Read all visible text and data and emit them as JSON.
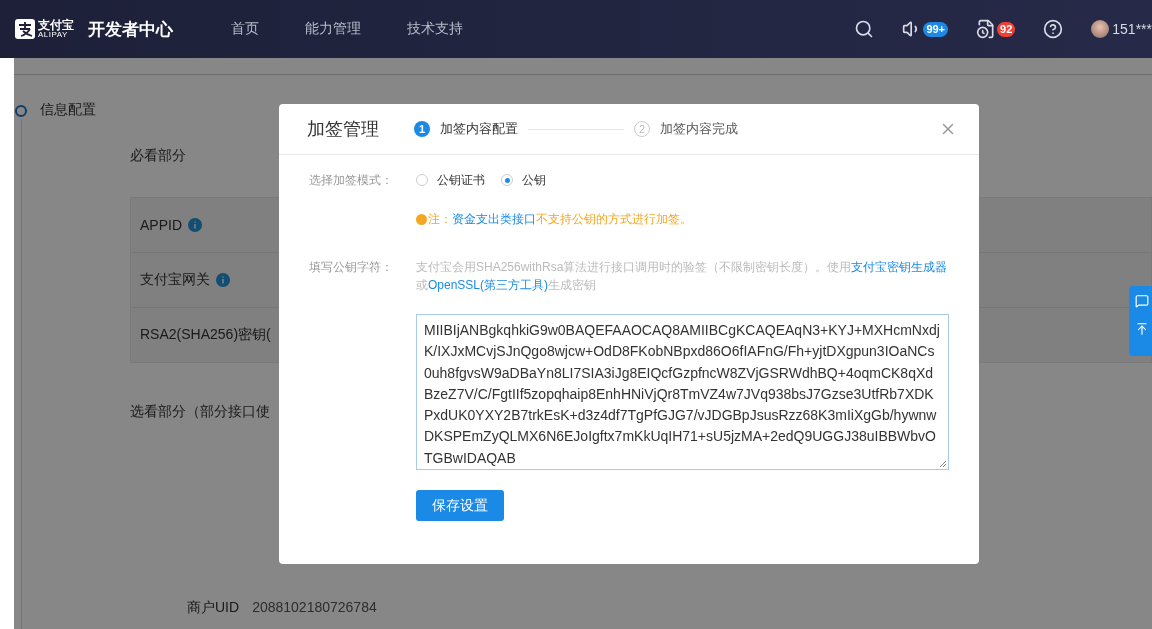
{
  "header": {
    "logo": {
      "name": "支付宝",
      "sub": "ALIPAY"
    },
    "title": "开发者中心",
    "nav": [
      {
        "label": "首页"
      },
      {
        "label": "能力管理"
      },
      {
        "label": "技术支持"
      }
    ],
    "notifications": [
      {
        "kind": "sound",
        "badge": "99+",
        "color": "#1e88e5"
      },
      {
        "kind": "task",
        "badge": "92",
        "color": "#f04134"
      }
    ],
    "user": "151***"
  },
  "page": {
    "section": "信息配置",
    "required_title": "必看部分",
    "required_rows": [
      {
        "label": "APPID",
        "info": true
      },
      {
        "label": "支付宝网关",
        "info": true
      },
      {
        "label": "RSA2(SHA256)密钥(",
        "info": false
      }
    ],
    "optional_title": "选看部分（部分接口使",
    "uid": {
      "label": "商户UID",
      "value": "2088102180726784"
    }
  },
  "modal": {
    "title": "加签管理",
    "steps": [
      {
        "number": "1",
        "label": "加签内容配置",
        "selected": true
      },
      {
        "number": "2",
        "label": "加签内容完成",
        "selected": false
      }
    ],
    "mode_label": "选择加签模式：",
    "modes": [
      {
        "label": "公钥证书",
        "selected": false
      },
      {
        "label": "公钥",
        "selected": true
      }
    ],
    "note": [
      {
        "kind": "warn",
        "text": "注："
      },
      {
        "kind": "link",
        "text": "资金支出类接口"
      },
      {
        "kind": "warn",
        "text": "不支持公钥的方式进行加签。"
      }
    ],
    "key_label": "填写公钥字符：",
    "hint": [
      {
        "kind": "plain",
        "text": "支付宝会用SHA256withRsa算法进行接口调用时的验签（不限制密钥长度）。使用"
      },
      {
        "kind": "link",
        "text": "支付宝密钥生成器"
      },
      {
        "kind": "plain",
        "text": "或"
      },
      {
        "kind": "link",
        "text": "OpenSSL(第三方工具)"
      },
      {
        "kind": "plain",
        "text": "生成密钥"
      }
    ],
    "key_lines": [
      "MIIBIjANBgkqhkiG9w0BAQEFAAOCAQ8AMIIBCgKCAQEAqN3+KYJ+MXHcmNxdj",
      "K/IXJxMCvjSJnQgo8wjcw+OdD8FKobNBpxd86O6fIAFnG/Fh+yjtDXgpun3IOaNCs",
      "0uh8fgvsW9aDBaYn8LI7SIA3iJg8EIQcfGzpfncW8ZVjGSRWdhBQ+4oqmCK8qXd",
      "BzeZ7V/C/FgtIIf5zopqhaip8EnhHNiVjQr8TmVZ4w7JVq938bsJ7Gzse3UtfRb7XDK",
      "PxdUK0YXY2B7trkEsK+d3z4df7TgPfGJG7/vJDGBpJsusRzz68K3mIiXgGb/hywnw",
      "DKSPEmZyQLMX6N6EJoIgftx7mKkUqIH71+sU5jzMA+2edQ9UGGJ38uIBBWbvO",
      "TGBwIDAQAB"
    ],
    "save": "保存设置"
  }
}
